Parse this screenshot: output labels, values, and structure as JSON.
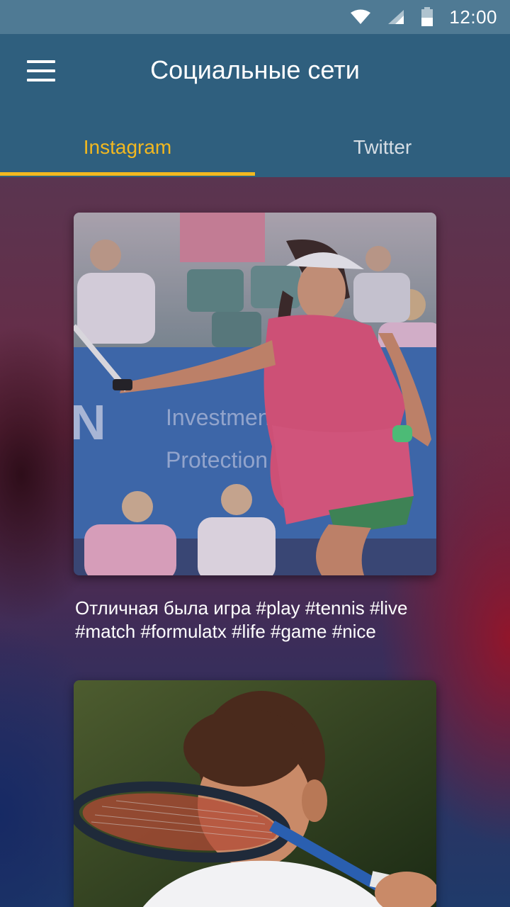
{
  "status_bar": {
    "time": "12:00",
    "icons": [
      "wifi-icon",
      "cellular-signal-icon",
      "battery-icon"
    ]
  },
  "app_bar": {
    "menu_icon": "hamburger-menu-icon",
    "title": "Социальные сети"
  },
  "tabs": [
    {
      "label": "Instagram",
      "active": true
    },
    {
      "label": "Twitter",
      "active": false
    }
  ],
  "posts": [
    {
      "caption": "Отличная была игра #play #tennis #live #match #formulatx #life #game #nice"
    },
    {
      "caption": ""
    }
  ],
  "colors": {
    "status_bar": "#4f7a94",
    "app_bar": "#2f5f7e",
    "accent": "#f2b820",
    "inactive_tab": "#d5dde4"
  }
}
